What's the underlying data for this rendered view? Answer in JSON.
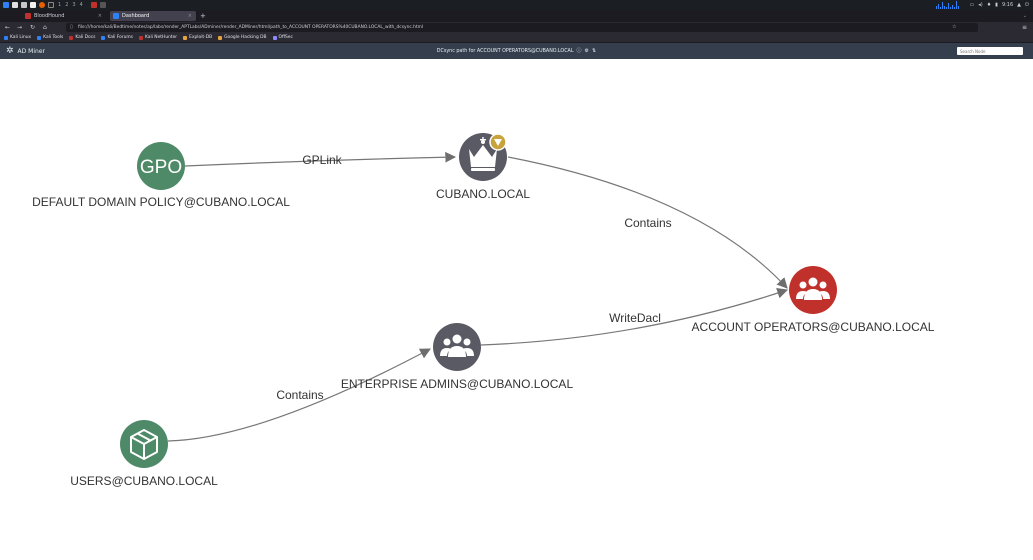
{
  "os": {
    "workspaces": [
      "1",
      "2",
      "3",
      "4"
    ],
    "clock": "9:16"
  },
  "browser": {
    "tabs": [
      {
        "label": "BloodHound",
        "active": false
      },
      {
        "label": "Dashboard",
        "active": true
      }
    ],
    "url": "file:///home/kali/Bedtime/notes/ap/labs/render_APTLabs/ADminer/render_ADMiner/html/path_to_ACCOUNT OPERATORS%40CUBANO.LOCAL_with_dcsync.html",
    "bookmarks": [
      "Kali Linux",
      "Kali Tools",
      "Kali Docs",
      "Kali Forums",
      "Kali NetHunter",
      "Exploit-DB",
      "Google Hacking DB",
      "OffSec"
    ]
  },
  "app": {
    "name": "AD Miner",
    "title": "DCsync path for ACCOUNT OPERATORS@CUBANO.LOCAL",
    "search_placeholder": "Search Node"
  },
  "graph": {
    "nodes": [
      {
        "id": "gpo",
        "label": "DEFAULT DOMAIN POLICY@CUBANO.LOCAL",
        "icon": "gpo-text-icon",
        "icon_text": "GPO",
        "color": "#4e8a67"
      },
      {
        "id": "domain",
        "label": "CUBANO.LOCAL",
        "icon": "crown-icon",
        "color": "#5a5a64",
        "badge_color": "#c8a23a"
      },
      {
        "id": "account_ops",
        "label": "ACCOUNT OPERATORS@CUBANO.LOCAL",
        "icon": "group-icon",
        "color": "#c0312b"
      },
      {
        "id": "ent_admins",
        "label": "ENTERPRISE ADMINS@CUBANO.LOCAL",
        "icon": "group-icon",
        "color": "#5a5a64"
      },
      {
        "id": "users",
        "label": "USERS@CUBANO.LOCAL",
        "icon": "ou-box-icon",
        "color": "#4e8a67"
      }
    ],
    "edges": [
      {
        "from": "gpo",
        "to": "domain",
        "label": "GPLink"
      },
      {
        "from": "domain",
        "to": "account_ops",
        "label": "Contains"
      },
      {
        "from": "ent_admins",
        "to": "account_ops",
        "label": "WriteDacl"
      },
      {
        "from": "users",
        "to": "ent_admins",
        "label": "Contains"
      }
    ]
  }
}
